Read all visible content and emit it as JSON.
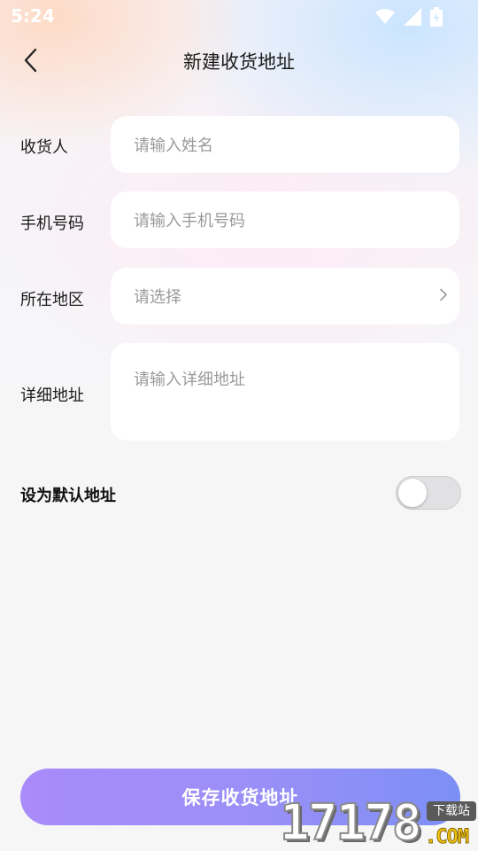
{
  "status_bar": {
    "time": "5:24",
    "icons": [
      "wifi-icon",
      "signal-icon",
      "battery-icon"
    ]
  },
  "nav": {
    "back_icon": "chevron-left-icon",
    "title": "新建收货地址"
  },
  "form": {
    "receiver": {
      "label": "收货人",
      "placeholder": "请输入姓名",
      "value": ""
    },
    "phone": {
      "label": "手机号码",
      "placeholder": "请输入手机号码",
      "value": ""
    },
    "region": {
      "label": "所在地区",
      "placeholder": "请选择",
      "value": "",
      "icon": "chevron-right-icon"
    },
    "detail": {
      "label": "详细地址",
      "placeholder": "请输入详细地址",
      "value": ""
    }
  },
  "default_address": {
    "label": "设为默认地址",
    "enabled": false
  },
  "save_button": {
    "label": "保存收货地址"
  },
  "watermark": {
    "digits": "17178",
    "badge": "下载站",
    "domain": ".COM"
  },
  "colors": {
    "accent_start": "#a98bf9",
    "accent_end": "#7c8ff5",
    "placeholder": "#9a9a9a",
    "text": "#1a1a1a",
    "toggle_off": "#e1e1e3"
  }
}
